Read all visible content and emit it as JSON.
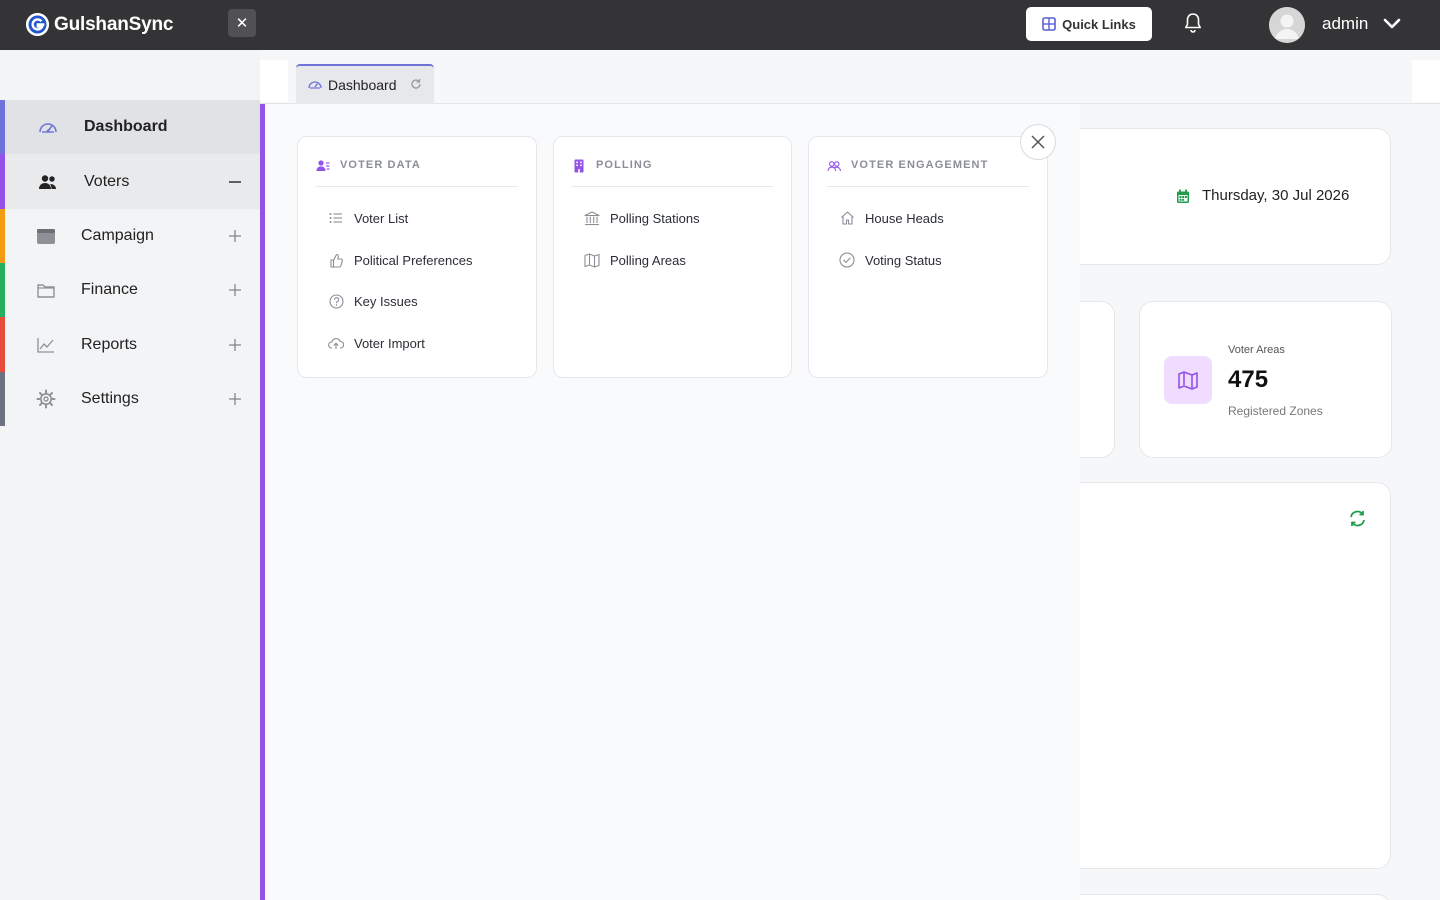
{
  "app": {
    "name": "GulshanSync"
  },
  "topbar": {
    "quick_links": "Quick Links",
    "user": "admin"
  },
  "sidebar": {
    "items": [
      {
        "label": "Dashboard",
        "icon": "dashboard-gauge-icon",
        "color": "#6e73d8",
        "state": "active"
      },
      {
        "label": "Voters",
        "icon": "users-icon",
        "color": "#9353e8",
        "state": "expanded"
      },
      {
        "label": "Campaign",
        "icon": "calendar-folder-icon",
        "color": "#f39c12",
        "state": "collapsed"
      },
      {
        "label": "Finance",
        "icon": "wallet-icon",
        "color": "#27ae60",
        "state": "collapsed"
      },
      {
        "label": "Reports",
        "icon": "chart-line-icon",
        "color": "#e74c3c",
        "state": "collapsed"
      },
      {
        "label": "Settings",
        "icon": "gear-icon",
        "color": "#6c7380",
        "state": "collapsed"
      }
    ]
  },
  "tabs": [
    {
      "label": "Dashboard",
      "active": true
    }
  ],
  "dashboard": {
    "date": "Thursday, 30 Jul 2026",
    "voter_areas": {
      "label": "Voter Areas",
      "value": "475",
      "sub": "Registered Zones"
    }
  },
  "mega_menu": {
    "columns": [
      {
        "title": "VOTER DATA",
        "icon": "user-list-icon",
        "links": [
          {
            "label": "Voter List",
            "icon": "list-icon"
          },
          {
            "label": "Political Preferences",
            "icon": "thumbs-up-icon"
          },
          {
            "label": "Key Issues",
            "icon": "question-circle-icon"
          },
          {
            "label": "Voter Import",
            "icon": "cloud-upload-icon"
          }
        ]
      },
      {
        "title": "POLLING",
        "icon": "building-icon",
        "links": [
          {
            "label": "Polling Stations",
            "icon": "bank-icon"
          },
          {
            "label": "Polling Areas",
            "icon": "map-icon"
          }
        ]
      },
      {
        "title": "VOTER ENGAGEMENT",
        "icon": "users-outline-icon",
        "links": [
          {
            "label": "House Heads",
            "icon": "home-icon"
          },
          {
            "label": "Voting Status",
            "icon": "check-circle-icon"
          }
        ]
      }
    ]
  },
  "colors": {
    "topbar": "#343436",
    "accent": "#9353e8",
    "tab_accent": "#6e73d8",
    "success": "#1e9e4a"
  }
}
